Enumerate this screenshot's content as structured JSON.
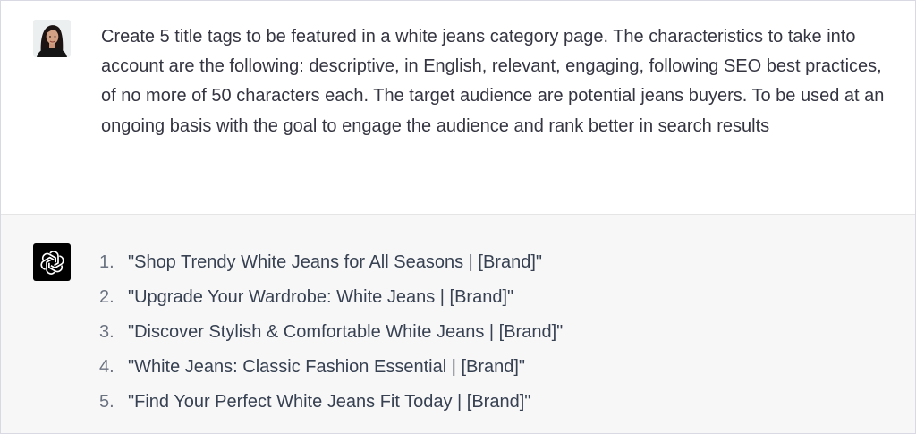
{
  "conversation": {
    "user_message": {
      "avatar": "user-photo-avatar",
      "text": "Create 5 title tags to be featured in a white jeans category page. The characteristics to take into account are the following: descriptive, in English, relevant, engaging, following SEO best practices, of no more of 50 characters each. The target audience are potential jeans buyers. To be used at an ongoing basis with the goal to engage the audience and rank better in search results"
    },
    "assistant_message": {
      "avatar": "openai-logo-icon",
      "items": [
        {
          "num": "1.",
          "text": "\"Shop Trendy White Jeans for All Seasons | [Brand]\""
        },
        {
          "num": "2.",
          "text": "\"Upgrade Your Wardrobe: White Jeans | [Brand]\""
        },
        {
          "num": "3.",
          "text": "\"Discover Stylish & Comfortable White Jeans | [Brand]\""
        },
        {
          "num": "4.",
          "text": "\"White Jeans: Classic Fashion Essential | [Brand]\""
        },
        {
          "num": "5.",
          "text": "\"Find Your Perfect White Jeans Fit Today | [Brand]\""
        }
      ]
    }
  },
  "colors": {
    "user_bg": "#ffffff",
    "assistant_bg": "#f7f7f8",
    "text": "#343541",
    "list_number": "#6b7280",
    "logo_bg": "#000000"
  }
}
